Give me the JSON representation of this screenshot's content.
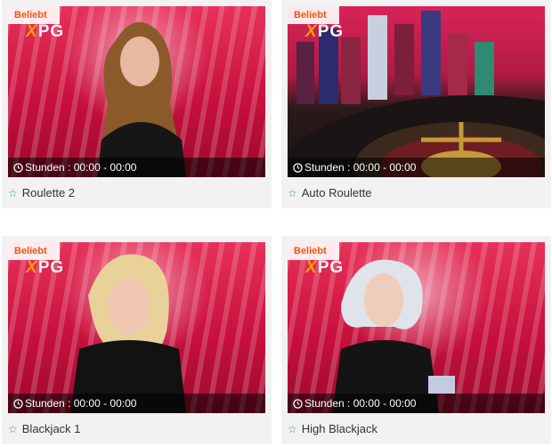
{
  "games": [
    {
      "title": "Roulette 2",
      "badge": "Beliebt",
      "logo": "XPG",
      "hours": "Stunden : 00:00 - 00:00"
    },
    {
      "title": "Auto Roulette",
      "badge": "Beliebt",
      "logo": "XPG",
      "hours": "Stunden : 00:00 - 00:00"
    },
    {
      "title": "Blackjack 1",
      "badge": "Beliebt",
      "logo": "XPG",
      "hours": "Stunden : 00:00 - 00:00"
    },
    {
      "title": "High Blackjack",
      "badge": "Beliebt",
      "logo": "XPG",
      "hours": "Stunden : 00:00 - 00:00"
    }
  ],
  "colors": {
    "badge_text": "#e85a12",
    "star": "#2ea54a"
  }
}
